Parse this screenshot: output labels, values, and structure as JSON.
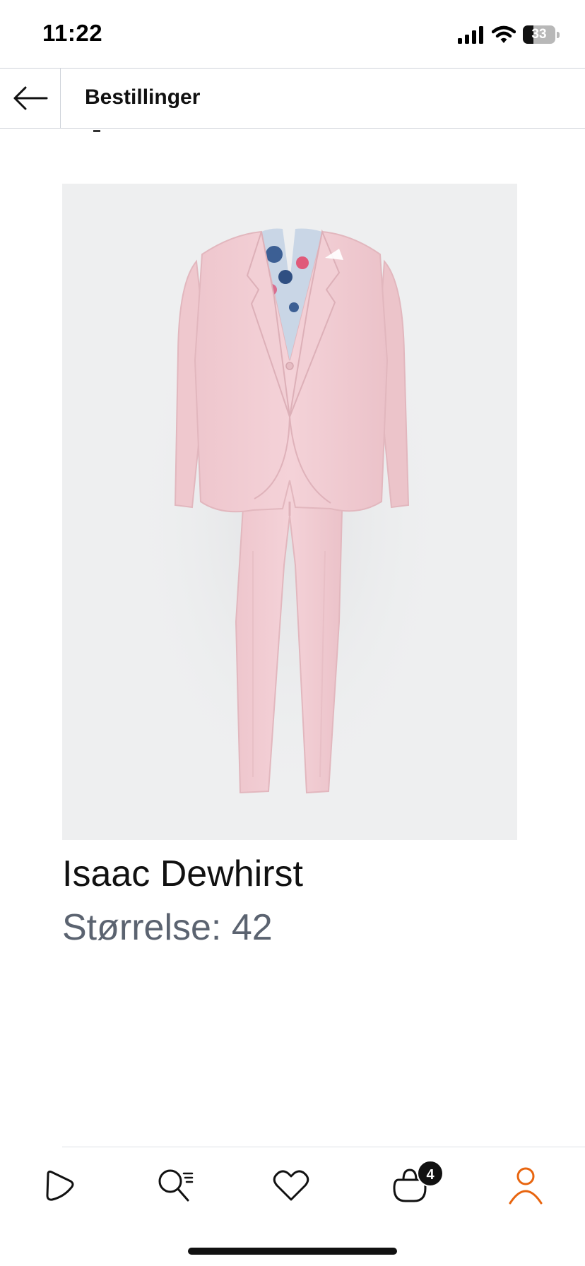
{
  "status_bar": {
    "time": "11:22",
    "battery_text": "33",
    "battery_level": 0.33,
    "icons": [
      "cellular-signal-icon",
      "wifi-icon",
      "battery-icon"
    ]
  },
  "header": {
    "title": "Bestillinger",
    "back_icon": "arrow-left-icon"
  },
  "product": {
    "brand": "Isaac Dewhirst",
    "size_text": "Størrelse: 42",
    "image_subject": "pink-suit"
  },
  "bottom_nav": {
    "items": [
      {
        "icon": "home-play-icon",
        "active": false
      },
      {
        "icon": "search-icon",
        "active": false
      },
      {
        "icon": "heart-icon",
        "active": false
      },
      {
        "icon": "bag-icon",
        "active": false,
        "badge": "4"
      },
      {
        "icon": "person-icon",
        "active": true
      }
    ],
    "active_color": "#e8650f",
    "inactive_color": "#111111"
  }
}
